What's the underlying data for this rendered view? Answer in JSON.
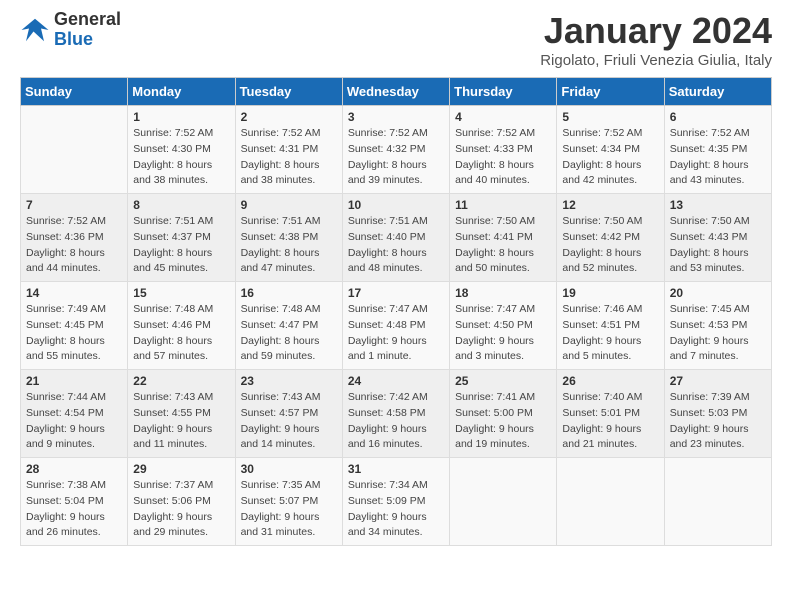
{
  "logo": {
    "general": "General",
    "blue": "Blue"
  },
  "title": "January 2024",
  "subtitle": "Rigolato, Friuli Venezia Giulia, Italy",
  "days_of_week": [
    "Sunday",
    "Monday",
    "Tuesday",
    "Wednesday",
    "Thursday",
    "Friday",
    "Saturday"
  ],
  "weeks": [
    [
      {
        "day": "",
        "sunrise": "",
        "sunset": "",
        "daylight": ""
      },
      {
        "day": "1",
        "sunrise": "Sunrise: 7:52 AM",
        "sunset": "Sunset: 4:30 PM",
        "daylight": "Daylight: 8 hours and 38 minutes."
      },
      {
        "day": "2",
        "sunrise": "Sunrise: 7:52 AM",
        "sunset": "Sunset: 4:31 PM",
        "daylight": "Daylight: 8 hours and 38 minutes."
      },
      {
        "day": "3",
        "sunrise": "Sunrise: 7:52 AM",
        "sunset": "Sunset: 4:32 PM",
        "daylight": "Daylight: 8 hours and 39 minutes."
      },
      {
        "day": "4",
        "sunrise": "Sunrise: 7:52 AM",
        "sunset": "Sunset: 4:33 PM",
        "daylight": "Daylight: 8 hours and 40 minutes."
      },
      {
        "day": "5",
        "sunrise": "Sunrise: 7:52 AM",
        "sunset": "Sunset: 4:34 PM",
        "daylight": "Daylight: 8 hours and 42 minutes."
      },
      {
        "day": "6",
        "sunrise": "Sunrise: 7:52 AM",
        "sunset": "Sunset: 4:35 PM",
        "daylight": "Daylight: 8 hours and 43 minutes."
      }
    ],
    [
      {
        "day": "7",
        "sunrise": "Sunrise: 7:52 AM",
        "sunset": "Sunset: 4:36 PM",
        "daylight": "Daylight: 8 hours and 44 minutes."
      },
      {
        "day": "8",
        "sunrise": "Sunrise: 7:51 AM",
        "sunset": "Sunset: 4:37 PM",
        "daylight": "Daylight: 8 hours and 45 minutes."
      },
      {
        "day": "9",
        "sunrise": "Sunrise: 7:51 AM",
        "sunset": "Sunset: 4:38 PM",
        "daylight": "Daylight: 8 hours and 47 minutes."
      },
      {
        "day": "10",
        "sunrise": "Sunrise: 7:51 AM",
        "sunset": "Sunset: 4:40 PM",
        "daylight": "Daylight: 8 hours and 48 minutes."
      },
      {
        "day": "11",
        "sunrise": "Sunrise: 7:50 AM",
        "sunset": "Sunset: 4:41 PM",
        "daylight": "Daylight: 8 hours and 50 minutes."
      },
      {
        "day": "12",
        "sunrise": "Sunrise: 7:50 AM",
        "sunset": "Sunset: 4:42 PM",
        "daylight": "Daylight: 8 hours and 52 minutes."
      },
      {
        "day": "13",
        "sunrise": "Sunrise: 7:50 AM",
        "sunset": "Sunset: 4:43 PM",
        "daylight": "Daylight: 8 hours and 53 minutes."
      }
    ],
    [
      {
        "day": "14",
        "sunrise": "Sunrise: 7:49 AM",
        "sunset": "Sunset: 4:45 PM",
        "daylight": "Daylight: 8 hours and 55 minutes."
      },
      {
        "day": "15",
        "sunrise": "Sunrise: 7:48 AM",
        "sunset": "Sunset: 4:46 PM",
        "daylight": "Daylight: 8 hours and 57 minutes."
      },
      {
        "day": "16",
        "sunrise": "Sunrise: 7:48 AM",
        "sunset": "Sunset: 4:47 PM",
        "daylight": "Daylight: 8 hours and 59 minutes."
      },
      {
        "day": "17",
        "sunrise": "Sunrise: 7:47 AM",
        "sunset": "Sunset: 4:48 PM",
        "daylight": "Daylight: 9 hours and 1 minute."
      },
      {
        "day": "18",
        "sunrise": "Sunrise: 7:47 AM",
        "sunset": "Sunset: 4:50 PM",
        "daylight": "Daylight: 9 hours and 3 minutes."
      },
      {
        "day": "19",
        "sunrise": "Sunrise: 7:46 AM",
        "sunset": "Sunset: 4:51 PM",
        "daylight": "Daylight: 9 hours and 5 minutes."
      },
      {
        "day": "20",
        "sunrise": "Sunrise: 7:45 AM",
        "sunset": "Sunset: 4:53 PM",
        "daylight": "Daylight: 9 hours and 7 minutes."
      }
    ],
    [
      {
        "day": "21",
        "sunrise": "Sunrise: 7:44 AM",
        "sunset": "Sunset: 4:54 PM",
        "daylight": "Daylight: 9 hours and 9 minutes."
      },
      {
        "day": "22",
        "sunrise": "Sunrise: 7:43 AM",
        "sunset": "Sunset: 4:55 PM",
        "daylight": "Daylight: 9 hours and 11 minutes."
      },
      {
        "day": "23",
        "sunrise": "Sunrise: 7:43 AM",
        "sunset": "Sunset: 4:57 PM",
        "daylight": "Daylight: 9 hours and 14 minutes."
      },
      {
        "day": "24",
        "sunrise": "Sunrise: 7:42 AM",
        "sunset": "Sunset: 4:58 PM",
        "daylight": "Daylight: 9 hours and 16 minutes."
      },
      {
        "day": "25",
        "sunrise": "Sunrise: 7:41 AM",
        "sunset": "Sunset: 5:00 PM",
        "daylight": "Daylight: 9 hours and 19 minutes."
      },
      {
        "day": "26",
        "sunrise": "Sunrise: 7:40 AM",
        "sunset": "Sunset: 5:01 PM",
        "daylight": "Daylight: 9 hours and 21 minutes."
      },
      {
        "day": "27",
        "sunrise": "Sunrise: 7:39 AM",
        "sunset": "Sunset: 5:03 PM",
        "daylight": "Daylight: 9 hours and 23 minutes."
      }
    ],
    [
      {
        "day": "28",
        "sunrise": "Sunrise: 7:38 AM",
        "sunset": "Sunset: 5:04 PM",
        "daylight": "Daylight: 9 hours and 26 minutes."
      },
      {
        "day": "29",
        "sunrise": "Sunrise: 7:37 AM",
        "sunset": "Sunset: 5:06 PM",
        "daylight": "Daylight: 9 hours and 29 minutes."
      },
      {
        "day": "30",
        "sunrise": "Sunrise: 7:35 AM",
        "sunset": "Sunset: 5:07 PM",
        "daylight": "Daylight: 9 hours and 31 minutes."
      },
      {
        "day": "31",
        "sunrise": "Sunrise: 7:34 AM",
        "sunset": "Sunset: 5:09 PM",
        "daylight": "Daylight: 9 hours and 34 minutes."
      },
      {
        "day": "",
        "sunrise": "",
        "sunset": "",
        "daylight": ""
      },
      {
        "day": "",
        "sunrise": "",
        "sunset": "",
        "daylight": ""
      },
      {
        "day": "",
        "sunrise": "",
        "sunset": "",
        "daylight": ""
      }
    ]
  ]
}
